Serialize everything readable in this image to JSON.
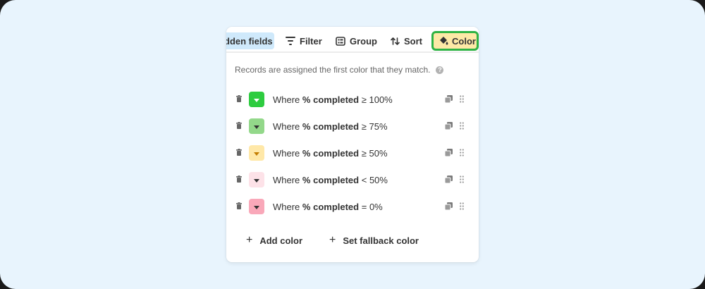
{
  "toolbar": {
    "hidden_fields_label": "dden fields",
    "filter_label": "Filter",
    "group_label": "Group",
    "sort_label": "Sort",
    "color_label": "Color"
  },
  "hint": {
    "text": "Records are assigned the first color that they match.",
    "help_icon": "?"
  },
  "rules": [
    {
      "prefix": "Where",
      "field": "% completed",
      "condition": "≥ 100%",
      "swatch": "#2ecc40",
      "caret_color": "#ffffff"
    },
    {
      "prefix": "Where",
      "field": "% completed",
      "condition": "≥ 75%",
      "swatch": "#93d88a",
      "caret_color": "#333333"
    },
    {
      "prefix": "Where",
      "field": "% completed",
      "condition": "≥ 50%",
      "swatch": "#ffe8a8",
      "caret_color": "#c47d00"
    },
    {
      "prefix": "Where",
      "field": "% completed",
      "condition": "< 50%",
      "swatch": "#fde2e8",
      "caret_color": "#333333"
    },
    {
      "prefix": "Where",
      "field": "% completed",
      "condition": "= 0%",
      "swatch": "#f9a8b9",
      "caret_color": "#333333"
    }
  ],
  "footer": {
    "add_color_label": "Add color",
    "fallback_label": "Set fallback color",
    "plus": "+"
  },
  "colors": {
    "background": "#e8f4fd",
    "active_button": "#fde9a6",
    "highlight_border": "#2fb344",
    "hidden_fields_bg": "#cfe9fb"
  }
}
